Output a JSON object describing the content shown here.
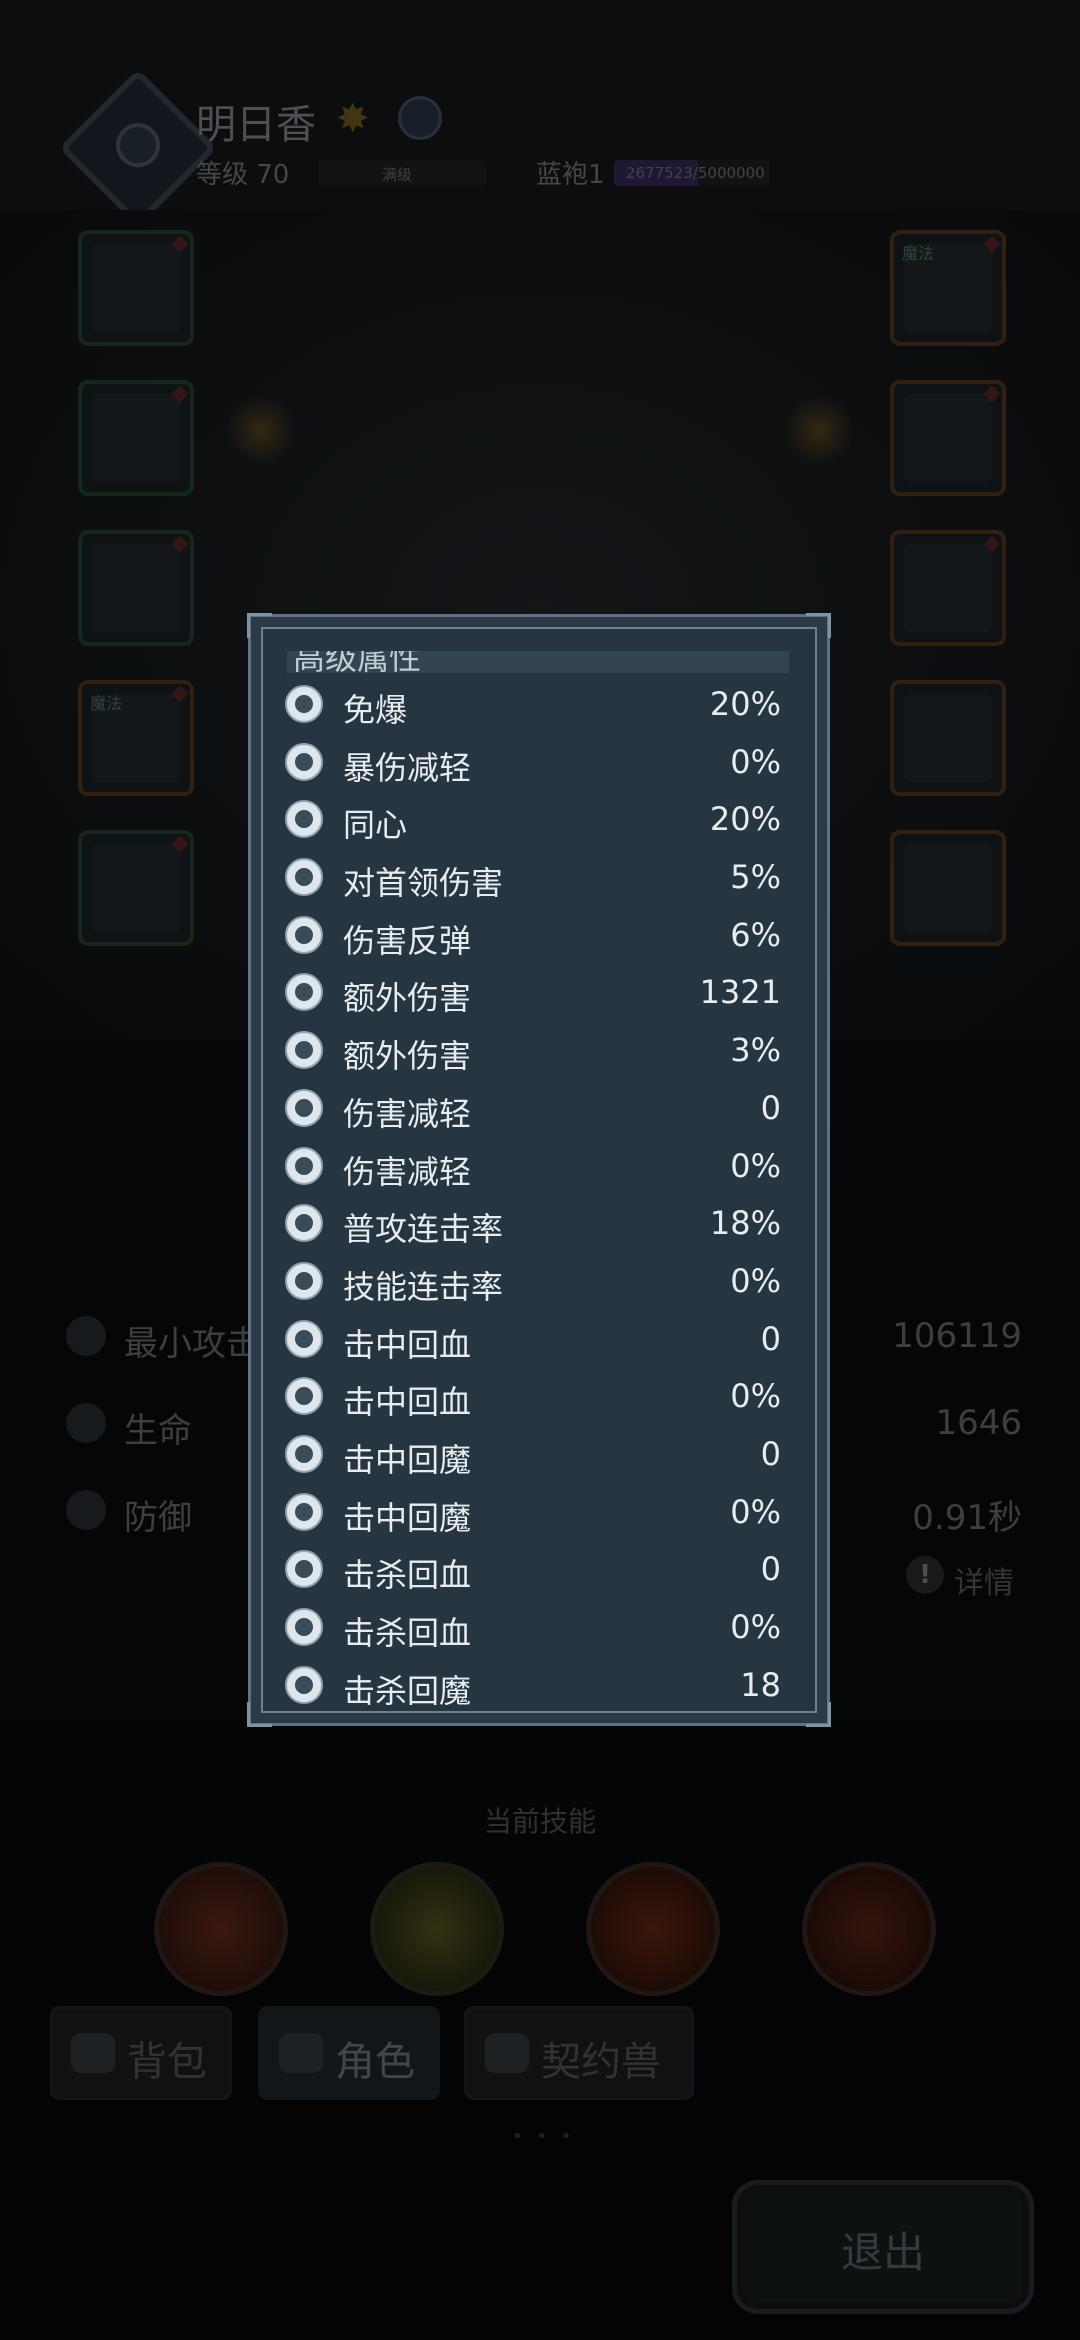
{
  "header": {
    "name": "明日香",
    "level": "等级 70",
    "level_bar_text": "满级",
    "robe_label": "蓝袍1",
    "robe_progress_text": "2677523/5000000",
    "robe_progress": 0.5355
  },
  "slots": {
    "left_tag": "魔法",
    "right_tag": "魔法"
  },
  "stats": [
    {
      "label": "最小攻击",
      "value": "106119"
    },
    {
      "label": "生命",
      "value": "1646"
    },
    {
      "label": "防御",
      "value": "0.91秒"
    }
  ],
  "detail_label": "详情",
  "skills_title": "当前技能",
  "tabs": {
    "bag": "背包",
    "role": "角色",
    "pet": "契约兽"
  },
  "page_dots": "• • •",
  "exit_label": "退出",
  "modal": {
    "section_title": "高级属性",
    "rows": [
      {
        "icon": "shield-cross-icon",
        "label": "免爆",
        "value": "20%"
      },
      {
        "icon": "swirl-icon",
        "label": "暴伤减轻",
        "value": "0%"
      },
      {
        "icon": "scroll-icon",
        "label": "同心",
        "value": "20%"
      },
      {
        "icon": "demon-head-icon",
        "label": "对首领伤害",
        "value": "5%"
      },
      {
        "icon": "bounce-icon",
        "label": "伤害反弹",
        "value": "6%"
      },
      {
        "icon": "boot-icon",
        "label": "额外伤害",
        "value": "1321"
      },
      {
        "icon": "boot-icon",
        "label": "额外伤害",
        "value": "3%"
      },
      {
        "icon": "armor-icon",
        "label": "伤害减轻",
        "value": "0"
      },
      {
        "icon": "armor-icon",
        "label": "伤害减轻",
        "value": "0%"
      },
      {
        "icon": "combo-icon",
        "label": "普攻连击率",
        "value": "18%"
      },
      {
        "icon": "skill-combo-icon",
        "label": "技能连击率",
        "value": "0%"
      },
      {
        "icon": "hit-heal-icon",
        "label": "击中回血",
        "value": "0"
      },
      {
        "icon": "hit-heal-icon",
        "label": "击中回血",
        "value": "0%"
      },
      {
        "icon": "hit-mana-icon",
        "label": "击中回魔",
        "value": "0"
      },
      {
        "icon": "hit-mana-icon",
        "label": "击中回魔",
        "value": "0%"
      },
      {
        "icon": "kill-heal-icon",
        "label": "击杀回血",
        "value": "0"
      },
      {
        "icon": "kill-heal-icon",
        "label": "击杀回血",
        "value": "0%"
      },
      {
        "icon": "kill-mana-icon",
        "label": "击杀回魔",
        "value": "18"
      }
    ]
  }
}
